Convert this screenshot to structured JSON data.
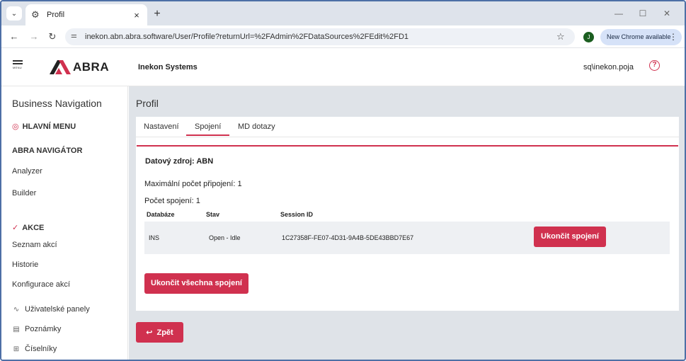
{
  "browser": {
    "tab_title": "Profil",
    "tab_menu_icon": "chevron-down-icon",
    "tab_favicon": "gear-icon",
    "close_tab_glyph": "×",
    "new_tab_glyph": "+",
    "url": "inekon.abn.abra.software/User/Profile?returnUrl=%2FAdmin%2FDataSources%2FEdit%2FD1",
    "profile_initial": "J",
    "chrome_available": "New Chrome available",
    "accent": "#d6e2f8"
  },
  "header": {
    "menu_label": "MENU",
    "logo_text": "ABRA",
    "company": "Inekon Systems",
    "username": "sq\\inekon.poja",
    "help_glyph": "?"
  },
  "sidebar": {
    "title": "Business Navigation",
    "sections": {
      "main_menu": "HLAVNÍ MENU",
      "navigator": "ABRA NAVIGÁTOR",
      "actions": "AKCE"
    },
    "navigator_items": [
      "Analyzer",
      "Builder"
    ],
    "action_items": [
      "Seznam akcí",
      "Historie",
      "Konfigurace akcí"
    ],
    "other_items": [
      {
        "label": "Uživatelské panely",
        "icon": "pulse-icon"
      },
      {
        "label": "Poznámky",
        "icon": "note-icon"
      },
      {
        "label": "Číselníky",
        "icon": "grid-icon"
      }
    ]
  },
  "main": {
    "page_title": "Profil",
    "tabs": [
      "Nastavení",
      "Spojení",
      "MD dotazy"
    ],
    "active_tab": "Spojení",
    "datasource": "Datový zdroj: ABN",
    "max_connections": "Maximální počet připojení: 1",
    "connections_count": "Počet spojení: 1",
    "table": {
      "headers": [
        "Databáze",
        "Stav",
        "Session ID"
      ],
      "rows": [
        {
          "database": "INS",
          "state": "Open - Idle",
          "session_id": "1C27358F-FE07-4D31-9A4B-5DE43BBD7E67",
          "action": "Ukončit spojení"
        }
      ]
    },
    "end_all": "Ukončit všechna spojení",
    "back": "Zpět"
  },
  "colors": {
    "brand_red": "#d0314f",
    "main_bg": "#dfe3e8"
  }
}
